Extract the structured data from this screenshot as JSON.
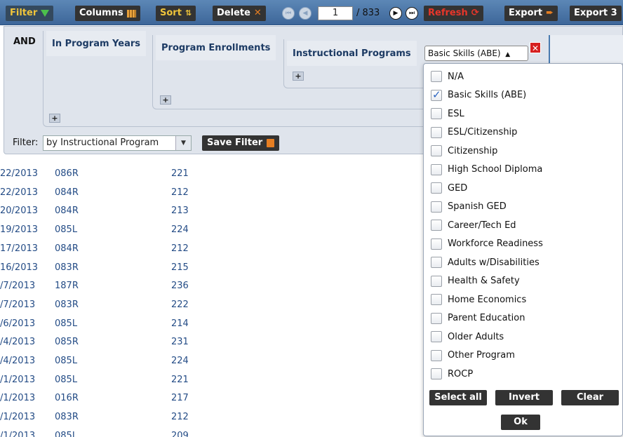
{
  "toolbar": {
    "filter_label": "Filter",
    "columns_label": "Columns",
    "sort_label": "Sort",
    "delete_label": "Delete",
    "page_value": "1",
    "page_total": "/ 833",
    "refresh_label": "Refresh",
    "export_label": "Export",
    "export2_label": "Export 3",
    "colors": {
      "filter_text": "#f0c43a",
      "refresh_text": "#e8362a",
      "bar": "#3d6699"
    }
  },
  "filter_panel": {
    "and_label": "AND",
    "groups": [
      {
        "title": "In Program Years"
      },
      {
        "title": "Program Enrollments"
      },
      {
        "title": "Instructional Programs"
      }
    ],
    "selected_value": "Basic Skills (ABE)",
    "filter_label": "Filter:",
    "filter_select_value": "by Instructional Program",
    "save_filter_label": "Save Filter"
  },
  "rows": [
    {
      "date": "22/2013",
      "code": "086R",
      "num": "221"
    },
    {
      "date": "22/2013",
      "code": "084R",
      "num": "212"
    },
    {
      "date": "20/2013",
      "code": "084R",
      "num": "213"
    },
    {
      "date": "19/2013",
      "code": "085L",
      "num": "224"
    },
    {
      "date": "17/2013",
      "code": "084R",
      "num": "212"
    },
    {
      "date": "16/2013",
      "code": "083R",
      "num": "215"
    },
    {
      "date": "/7/2013",
      "code": "187R",
      "num": "236"
    },
    {
      "date": "/7/2013",
      "code": "083R",
      "num": "222"
    },
    {
      "date": "/6/2013",
      "code": "085L",
      "num": "214"
    },
    {
      "date": "/4/2013",
      "code": "085R",
      "num": "231"
    },
    {
      "date": "/4/2013",
      "code": "085L",
      "num": "224"
    },
    {
      "date": "/1/2013",
      "code": "085L",
      "num": "221"
    },
    {
      "date": "/1/2013",
      "code": "016R",
      "num": "217"
    },
    {
      "date": "/1/2013",
      "code": "083R",
      "num": "212"
    },
    {
      "date": "/1/2013",
      "code": "085L",
      "num": "209"
    }
  ],
  "dropdown": {
    "options": [
      {
        "label": "N/A",
        "checked": false
      },
      {
        "label": "Basic Skills (ABE)",
        "checked": true
      },
      {
        "label": "ESL",
        "checked": false
      },
      {
        "label": "ESL/Citizenship",
        "checked": false
      },
      {
        "label": "Citizenship",
        "checked": false
      },
      {
        "label": "High School Diploma",
        "checked": false
      },
      {
        "label": "GED",
        "checked": false
      },
      {
        "label": "Spanish GED",
        "checked": false
      },
      {
        "label": "Career/Tech Ed",
        "checked": false
      },
      {
        "label": "Workforce Readiness",
        "checked": false
      },
      {
        "label": "Adults w/Disabilities",
        "checked": false
      },
      {
        "label": "Health & Safety",
        "checked": false
      },
      {
        "label": "Home Economics",
        "checked": false
      },
      {
        "label": "Parent Education",
        "checked": false
      },
      {
        "label": "Older Adults",
        "checked": false
      },
      {
        "label": "Other Program",
        "checked": false
      },
      {
        "label": "ROCP",
        "checked": false
      }
    ],
    "select_all_label": "Select all",
    "invert_label": "Invert",
    "clear_label": "Clear",
    "ok_label": "Ok"
  }
}
